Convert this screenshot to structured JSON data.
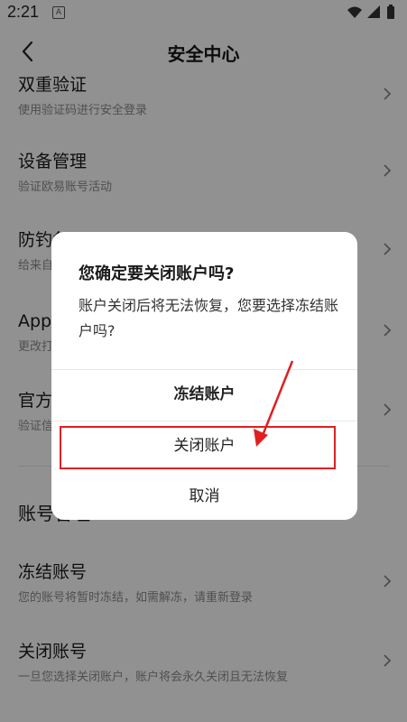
{
  "status_bar": {
    "time": "2:21",
    "notif_badge": "A"
  },
  "nav": {
    "title": "安全中心"
  },
  "settings": [
    {
      "title": "双重验证",
      "desc": "使用验证码进行安全登录"
    },
    {
      "title": "设备管理",
      "desc": "验证欧易账号活动"
    },
    {
      "title": "防钓鱼码",
      "desc": "给来自欧易的邮件设置防钓鱼码"
    },
    {
      "title": "App 锁",
      "desc": "更改打开 App 时的解锁方式"
    },
    {
      "title": "官方验证",
      "desc": "验证信息来源是否为欧易官方"
    }
  ],
  "account_section": {
    "title": "账号管理",
    "items": [
      {
        "title": "冻结账号",
        "desc": "您的账号将暂时冻结，如需解冻，请重新登录"
      },
      {
        "title": "关闭账号",
        "desc": "一旦您选择关闭账户，账户将会永久关闭且无法恢复"
      }
    ]
  },
  "dialog": {
    "title": "您确定要关闭账户吗?",
    "message": "账户关闭后将无法恢复，您要选择冻结账户吗?",
    "freeze_button": "冻结账户",
    "close_button": "关闭账户",
    "cancel_button": "取消"
  },
  "colors": {
    "annotation": "#e02020",
    "overlay": "rgba(0,0,0,0.43)"
  }
}
